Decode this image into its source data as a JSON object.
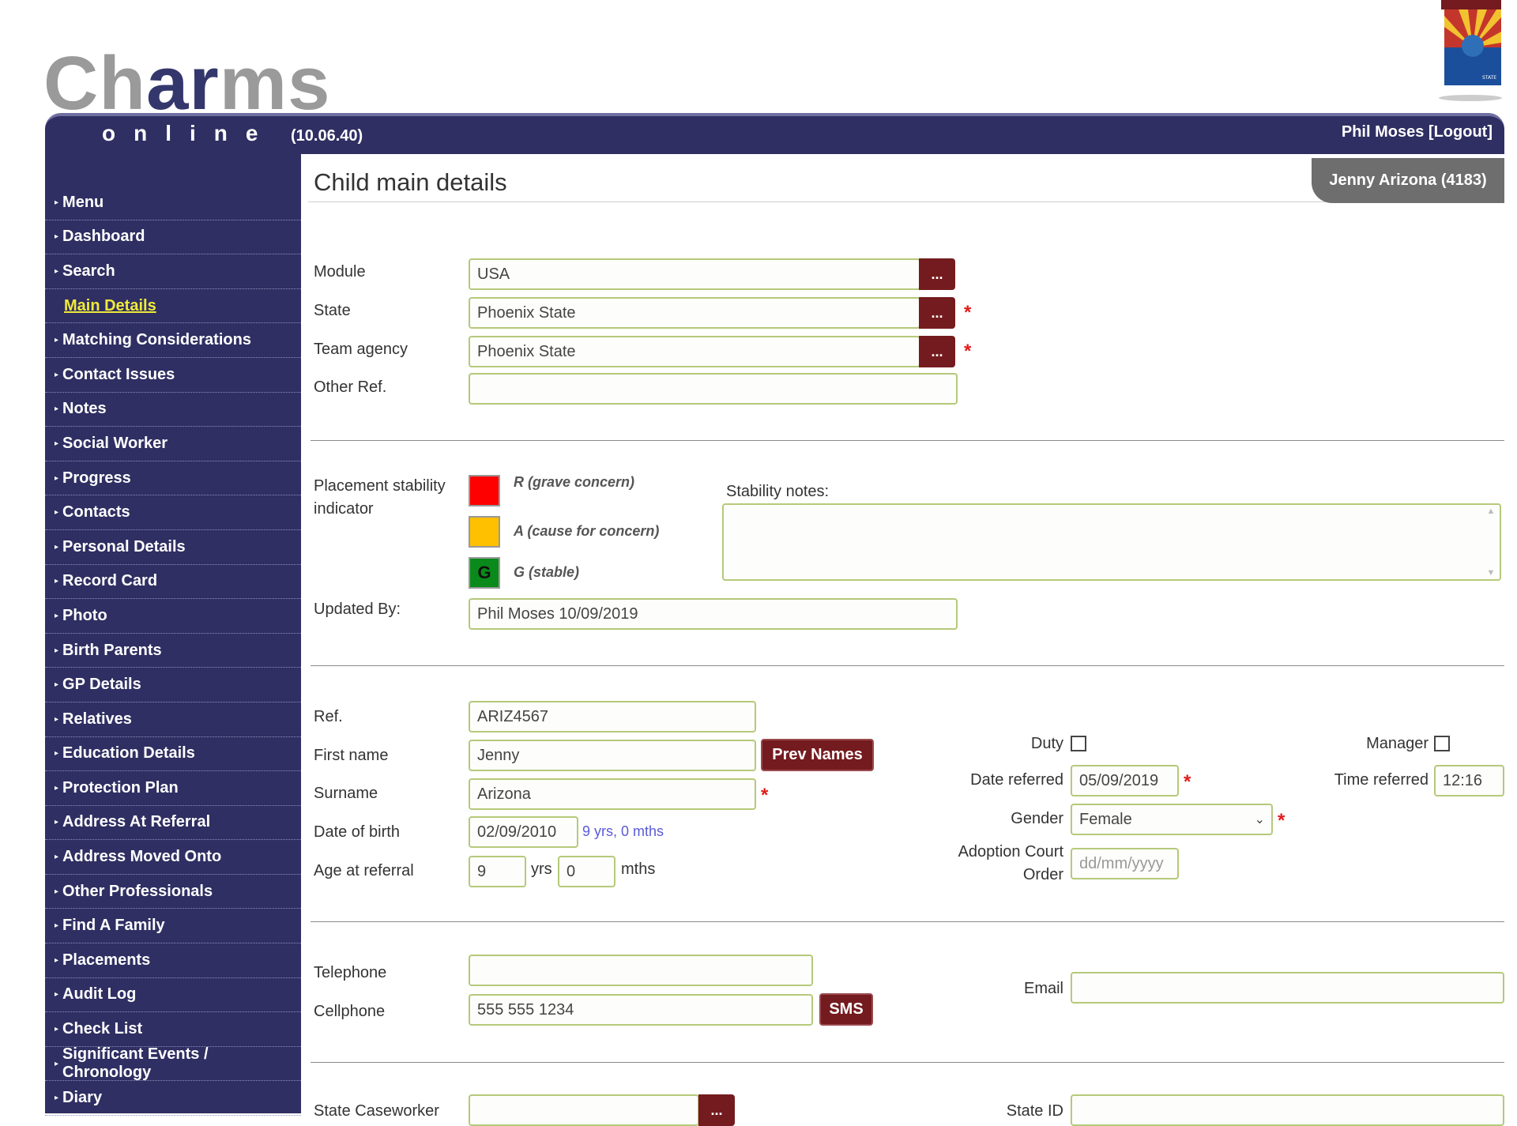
{
  "app": {
    "logo_part1": "Ch",
    "logo_part2": "ar",
    "logo_part3": "ms",
    "online_word": "online",
    "version": "(10.06.40)",
    "user_name": "Phil Moses",
    "logout_label": "[Logout]"
  },
  "sidebar": {
    "items": [
      {
        "label": "Menu"
      },
      {
        "label": "Dashboard"
      },
      {
        "label": "Search"
      },
      {
        "label": "Main Details",
        "active": true
      },
      {
        "label": "Matching Considerations"
      },
      {
        "label": "Contact Issues"
      },
      {
        "label": "Notes"
      },
      {
        "label": "Social Worker"
      },
      {
        "label": "Progress"
      },
      {
        "label": "Contacts"
      },
      {
        "label": "Personal Details"
      },
      {
        "label": "Record Card"
      },
      {
        "label": "Photo"
      },
      {
        "label": "Birth Parents"
      },
      {
        "label": "GP Details"
      },
      {
        "label": "Relatives"
      },
      {
        "label": "Education Details"
      },
      {
        "label": "Protection Plan"
      },
      {
        "label": "Address At Referral"
      },
      {
        "label": "Address Moved Onto"
      },
      {
        "label": "Other Professionals"
      },
      {
        "label": "Find A Family"
      },
      {
        "label": "Placements"
      },
      {
        "label": "Audit Log"
      },
      {
        "label": "Check List"
      },
      {
        "label": "Significant Events / Chronology"
      },
      {
        "label": "Diary"
      }
    ]
  },
  "main": {
    "page_title": "Child main details",
    "child_tab": "Jenny Arizona (4183)",
    "module": {
      "label": "Module",
      "value": "USA",
      "btn": "..."
    },
    "state": {
      "label": "State",
      "value": "Phoenix State",
      "btn": "..."
    },
    "team_agency": {
      "label": "Team agency",
      "value": "Phoenix State",
      "btn": "..."
    },
    "other_ref": {
      "label": "Other Ref.",
      "value": ""
    },
    "stability": {
      "label": "Placement stability indicator",
      "r_label": "R (grave concern)",
      "a_label": "A (cause for concern)",
      "g_label": "G (stable)",
      "g_letter": "G",
      "notes_label": "Stability notes:",
      "notes_value": ""
    },
    "updated_by": {
      "label": "Updated By:",
      "value": "Phil Moses 10/09/2019"
    },
    "ref": {
      "label": "Ref.",
      "value": "ARIZ4567"
    },
    "first_name": {
      "label": "First name",
      "value": "Jenny",
      "btn": "Prev Names"
    },
    "surname": {
      "label": "Surname",
      "value": "Arizona"
    },
    "dob": {
      "label": "Date of birth",
      "value": "02/09/2010",
      "age_hint": "9 yrs, 0 mths"
    },
    "age_at_referral": {
      "label": "Age at referral",
      "years": "9",
      "years_unit": "yrs",
      "months": "0",
      "months_unit": "mths"
    },
    "duty": {
      "label": "Duty",
      "checked": false
    },
    "manager": {
      "label": "Manager",
      "checked": false
    },
    "date_referred": {
      "label": "Date referred",
      "value": "05/09/2019"
    },
    "time_referred": {
      "label": "Time referred",
      "value": "12:16"
    },
    "gender": {
      "label": "Gender",
      "value": "Female"
    },
    "adoption_court_order": {
      "label_line1": "Adoption Court",
      "label_line2": "Order",
      "placeholder": "dd/mm/yyyy"
    },
    "telephone": {
      "label": "Telephone",
      "value": ""
    },
    "cellphone": {
      "label": "Cellphone",
      "value": "555 555 1234",
      "btn": "SMS"
    },
    "email": {
      "label": "Email",
      "value": ""
    },
    "state_caseworker": {
      "label": "State Caseworker",
      "value": "",
      "btn": "..."
    },
    "state_id": {
      "label": "State ID",
      "value": ""
    }
  },
  "colors": {
    "nav_bg": "#2f2f63",
    "button_bg": "#741b1f",
    "field_border": "#b5c97a",
    "required": "#e21b1b",
    "red": "#ff0000",
    "amber": "#ffc000",
    "green": "#0a8a1a"
  }
}
